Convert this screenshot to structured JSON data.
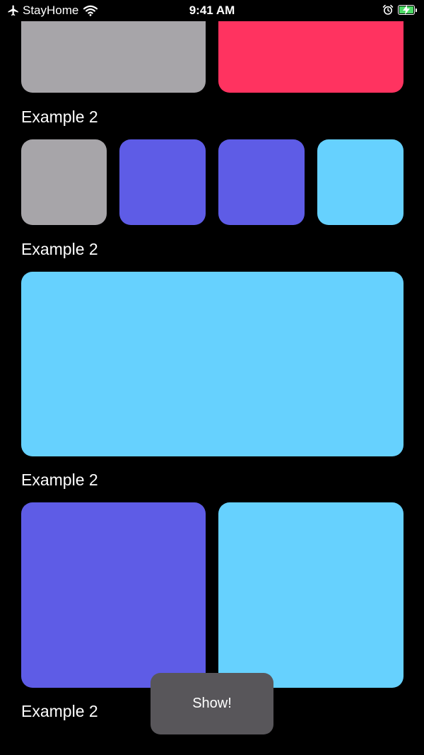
{
  "status_bar": {
    "carrier": "StayHome",
    "time": "9:41 AM",
    "icons": [
      "airplane-icon",
      "wifi-icon",
      "alarm-icon",
      "battery-charging-icon"
    ],
    "battery_color": "#4cd964"
  },
  "sections": [
    {
      "label": "Example 2",
      "tiles": [
        "gray",
        "red"
      ]
    },
    {
      "label": "Example 2",
      "tiles": [
        "gray",
        "indigo",
        "indigo",
        "light-blue"
      ]
    },
    {
      "label": "Example 2",
      "tiles": [
        "light-blue"
      ]
    },
    {
      "label": "Example 2",
      "tiles": [
        "indigo",
        "light-blue"
      ]
    }
  ],
  "colors": {
    "gray": "#a7a5a9",
    "red": "#ff3360",
    "indigo": "#5e5ce6",
    "light-blue": "#66d1fe",
    "background": "#000000",
    "toast": "#58565a"
  },
  "toast": {
    "label": "Show!"
  }
}
